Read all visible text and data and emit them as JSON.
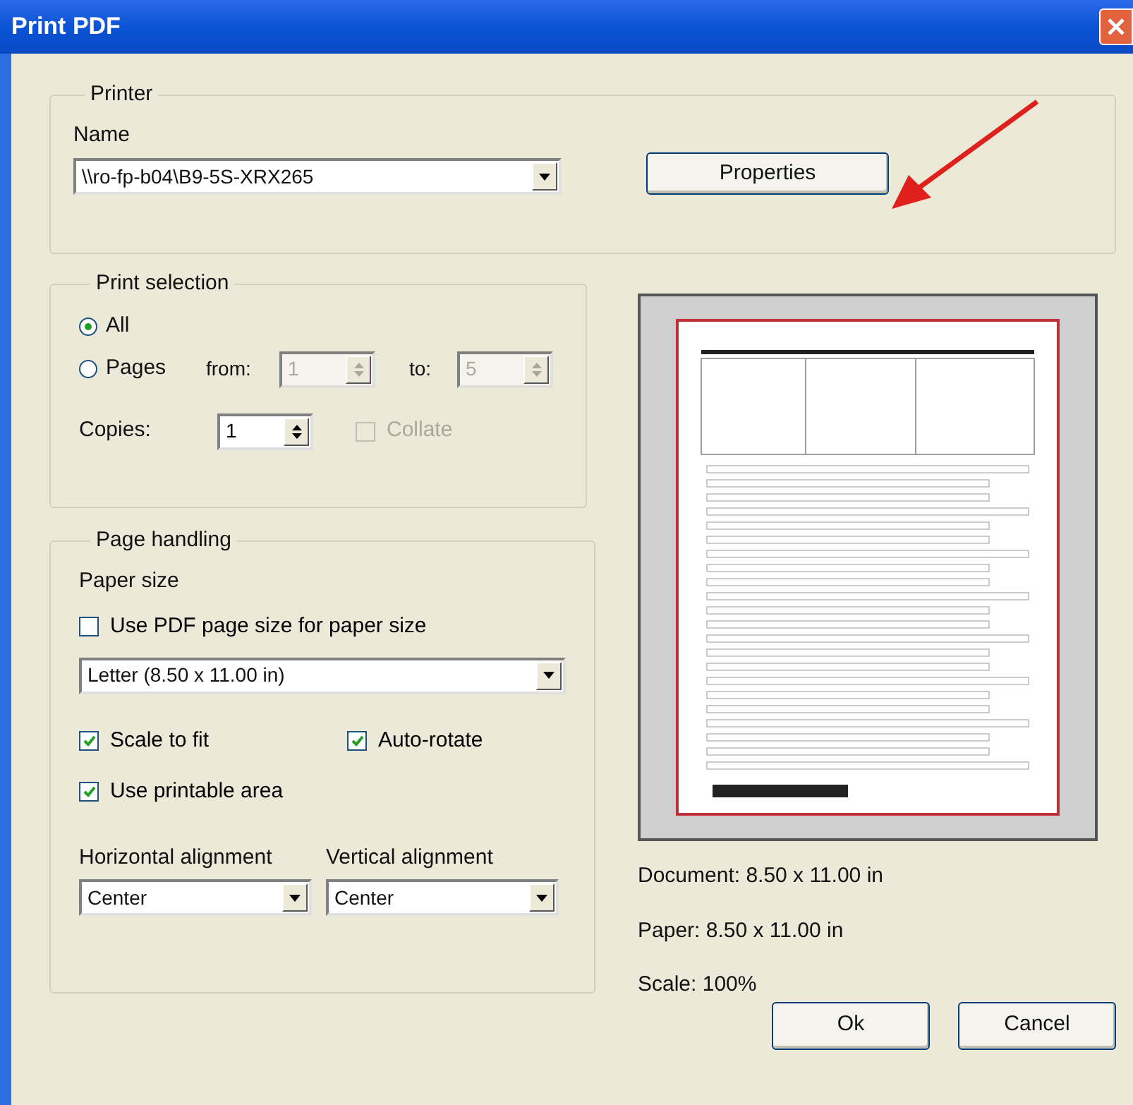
{
  "window": {
    "title": "Print PDF"
  },
  "printer": {
    "group_label": "Printer",
    "name_label": "Name",
    "name_value": "\\\\ro-fp-b04\\B9-5S-XRX265",
    "properties_button": "Properties"
  },
  "print_selection": {
    "group_label": "Print selection",
    "options": [
      {
        "label": "All",
        "selected": true
      },
      {
        "label": "Pages",
        "selected": false
      }
    ],
    "from_label": "from:",
    "from_value": "1",
    "to_label": "to:",
    "to_value": "5",
    "range_disabled": true,
    "copies_label": "Copies:",
    "copies_value": "1",
    "collate": {
      "label": "Collate",
      "checked": false,
      "disabled": true
    }
  },
  "page_handling": {
    "group_label": "Page handling",
    "paper_size_label": "Paper size",
    "use_pdf_size": {
      "label": "Use PDF page size for paper size",
      "checked": false,
      "disabled": false
    },
    "paper_size_value": "Letter (8.50 x 11.00 in)",
    "options": [
      {
        "label": "Scale to fit",
        "checked": true,
        "disabled": false
      },
      {
        "label": "Auto-rotate",
        "checked": true,
        "disabled": false
      },
      {
        "label": "Use printable area",
        "checked": true,
        "disabled": false
      }
    ],
    "horizontal_label": "Horizontal alignment",
    "horizontal_value": "Center",
    "vertical_label": "Vertical alignment",
    "vertical_value": "Center"
  },
  "preview": {
    "info": [
      "Document: 8.50 x 11.00 in",
      "Paper: 8.50 x 11.00 in",
      "Scale: 100%"
    ]
  },
  "buttons": [
    "Ok",
    "Cancel"
  ]
}
